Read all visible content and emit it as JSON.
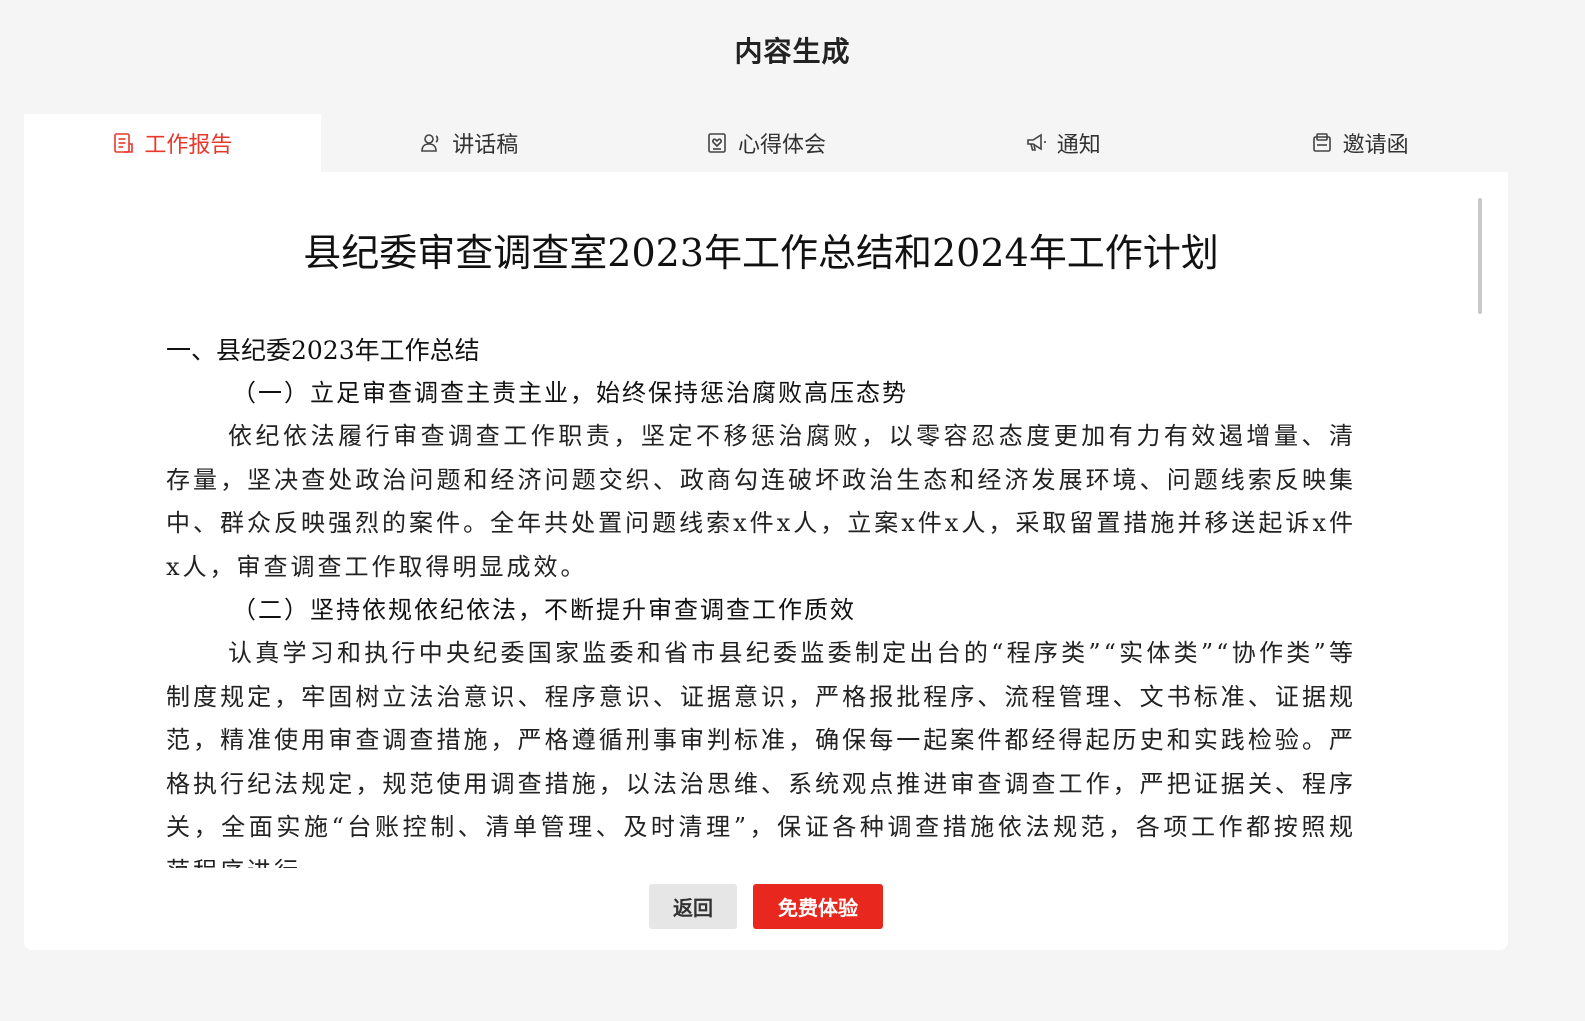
{
  "header": {
    "title": "内容生成"
  },
  "tabs": [
    {
      "label": "工作报告",
      "icon": "document-icon",
      "active": true
    },
    {
      "label": "讲话稿",
      "icon": "user-speech-icon",
      "active": false
    },
    {
      "label": "心得体会",
      "icon": "heart-note-icon",
      "active": false
    },
    {
      "label": "通知",
      "icon": "megaphone-icon",
      "active": false
    },
    {
      "label": "邀请函",
      "icon": "invitation-icon",
      "active": false
    }
  ],
  "colors": {
    "accent": "#e8382b",
    "button_primary": "#e8281e",
    "button_secondary": "#e6e6e6"
  },
  "document": {
    "title": "县纪委审查调查室2023年工作总结和2024年工作计划",
    "section1_heading": "一、县纪委2023年工作总结",
    "sub1_heading": "（一）立足审查调查主责主业，始终保持惩治腐败高压态势",
    "sub1_para": "依纪依法履行审查调查工作职责，坚定不移惩治腐败，以零容忍态度更加有力有效遏增量、清存量，坚决查处政治问题和经济问题交织、政商勾连破坏政治生态和经济发展环境、问题线索反映集中、群众反映强烈的案件。全年共处置问题线索x件x人，立案x件x人，采取留置措施并移送起诉x件x人，审查调查工作取得明显成效。",
    "sub2_heading": "（二）坚持依规依纪依法，不断提升审查调查工作质效",
    "sub2_para": "认真学习和执行中央纪委国家监委和省市县纪委监委制定出台的“程序类”“实体类”“协作类”等制度规定，牢固树立法治意识、程序意识、证据意识，严格报批程序、流程管理、文书标准、证据规范，精准使用审查调查措施，严格遵循刑事审判标准，确保每一起案件都经得起历史和实践检验。严格执行纪法规定，规范使用调查措施，以法治思维、系统观点推进审查调查工作，严把证据关、程序关，全面实施“台账控制、清单管理、及时清理”，保证各种调查措施依法规范，各项工作都按照规范程序进行。"
  },
  "buttons": {
    "back_label": "返回",
    "try_label": "免费体验"
  }
}
